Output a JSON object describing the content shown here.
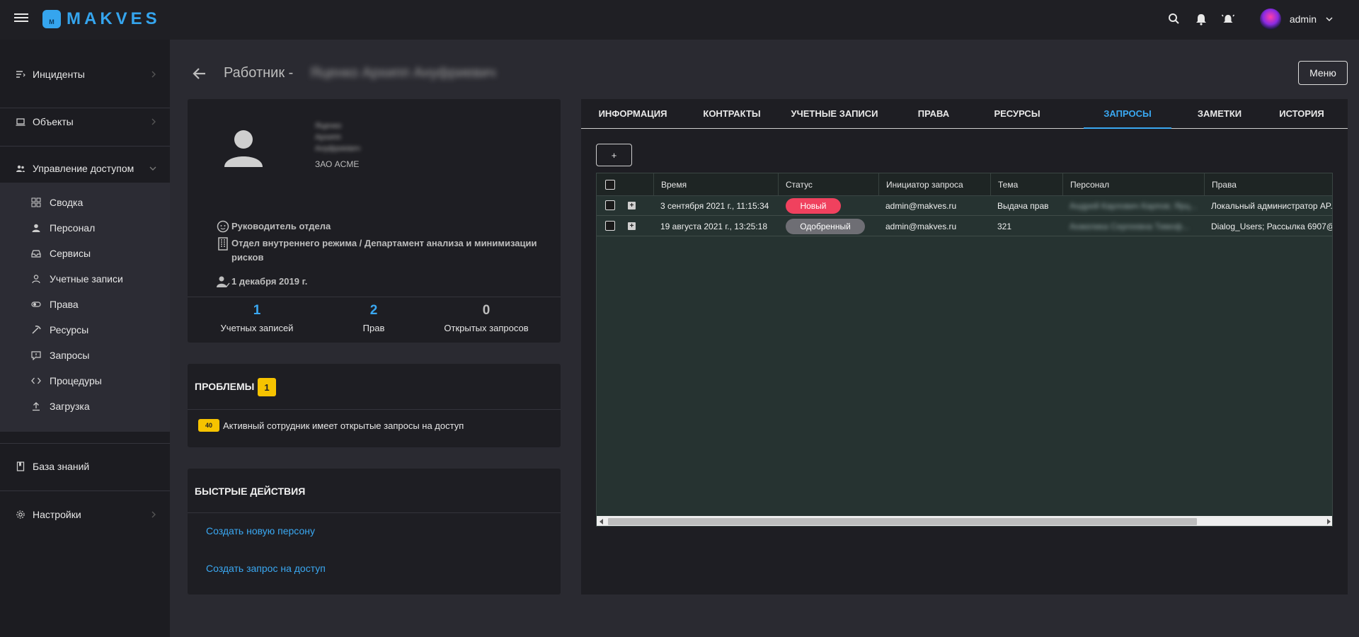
{
  "app": {
    "logo_text": "MAKVES",
    "logo_mark": "M",
    "user_name": "admin",
    "accent": "#3aa8f2"
  },
  "sidebar": {
    "incidents": "Инциденты",
    "objects": "Объекты",
    "access_management": "Управление доступом",
    "sub_items": [
      "Сводка",
      "Персонал",
      "Сервисы",
      "Учетные записи",
      "Права",
      "Ресурсы",
      "Запросы",
      "Процедуры",
      "Загрузка"
    ],
    "knowledge_base": "База знаний",
    "settings": "Настройки"
  },
  "header": {
    "title": "Работник -",
    "title_name_blurred": "Яценко Архипп Ануфриевич",
    "menu_button": "Меню"
  },
  "profile": {
    "name_lines_blurred": [
      "Яценко",
      "Архипп",
      "Ануфриевич"
    ],
    "org": "ЗАО ACME",
    "position": "Руководитель отдела",
    "department": "Отдел внутреннего режима / Департамент анализа и минимизации рисков",
    "hire_date": "1 декабря 2019 г.",
    "stats": [
      {
        "value": "1",
        "caption": "Учетных записей",
        "color": "#3aa8f2"
      },
      {
        "value": "2",
        "caption": "Прав",
        "color": "#3aa8f2"
      },
      {
        "value": "0",
        "caption": "Открытых запросов",
        "color": "#bdbdbd"
      }
    ]
  },
  "problems": {
    "title": "ПРОБЛЕМЫ",
    "count": "1",
    "item_badge": "40",
    "item_text": "Активный сотрудник имеет открытые запросы на доступ"
  },
  "quick_actions": {
    "title": "БЫСТРЫЕ ДЕЙСТВИЯ",
    "links": [
      "Создать новую персону",
      "Создать запрос на доступ"
    ]
  },
  "tabs": [
    "ИНФОРМАЦИЯ",
    "КОНТРАКТЫ",
    "УЧЕТНЫЕ ЗАПИСИ",
    "ПРАВА",
    "РЕСУРСЫ",
    "ЗАПРОСЫ",
    "ЗАМЕТКИ",
    "ИСТОРИЯ"
  ],
  "active_tab": "ЗАПРОСЫ",
  "add_button": "+",
  "table": {
    "columns": [
      "Время",
      "Статус",
      "Инициатор запроса",
      "Тема",
      "Персонал",
      "Права"
    ],
    "rows": [
      {
        "time": "3 сентября 2021 г., 11:15:34",
        "status": "Новый",
        "status_color": "#f0415e",
        "initiator": "admin@makves.ru",
        "topic": "Выдача прав",
        "personnel_blurred": "Андрей Карлович Карпов; Ярц...",
        "rights": "Локальный администратор AP..."
      },
      {
        "time": "19 августа 2021 г., 13:25:18",
        "status": "Одобренный",
        "status_color": "#6e6e74",
        "initiator": "admin@makves.ru",
        "topic": "321",
        "personnel_blurred": "Анжелика Сергеевна Тимоф...",
        "rights": "Dialog_Users; Рассылка 6907@..."
      }
    ]
  }
}
